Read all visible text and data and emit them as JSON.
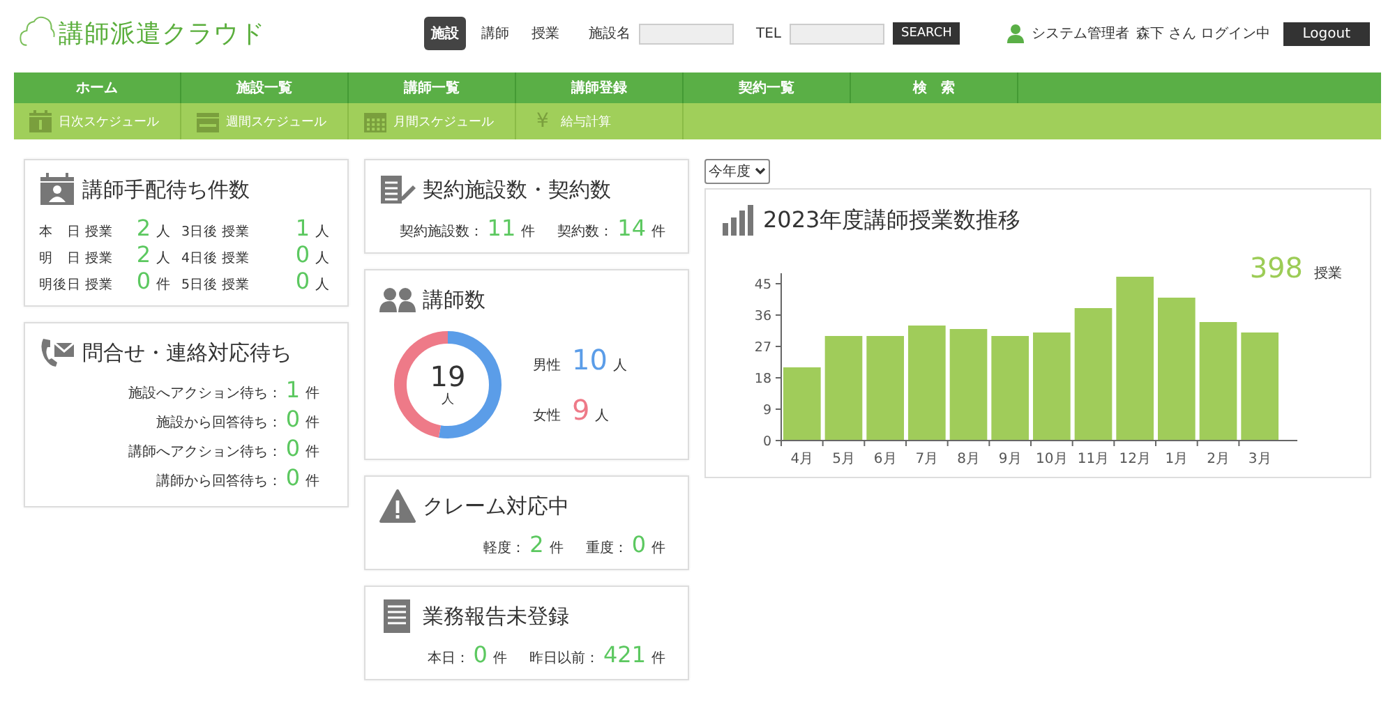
{
  "logo": "講師派遣クラウド",
  "search": {
    "tabs": [
      {
        "label": "施設",
        "selected": true
      },
      {
        "label": "講師",
        "selected": false
      },
      {
        "label": "授業",
        "selected": false
      }
    ],
    "fields": [
      {
        "label": "施設名"
      },
      {
        "label": "TEL"
      }
    ],
    "button": "SEARCH"
  },
  "user": {
    "role": "システム管理者",
    "status": "森下 さん ログイン中",
    "logout": "Logout"
  },
  "main_nav": [
    "ホーム",
    "施設一覧",
    "講師一覧",
    "講師登録",
    "契約一覧",
    "検　索"
  ],
  "sub_nav": [
    {
      "kind": "day",
      "label": "日次スケジュール"
    },
    {
      "kind": "week",
      "label": "週間スケジュール"
    },
    {
      "kind": "month",
      "label": "月間スケジュール"
    },
    {
      "kind": "glyph",
      "icon": "¥",
      "label": "給与計算"
    }
  ],
  "left_cards": [
    {
      "kind": "grid",
      "title": "講師手配待ち件数",
      "items": [
        {
          "label": "本　日 授業",
          "value": "2",
          "unit": "人"
        },
        {
          "label": "3日後 授業",
          "value": "1",
          "unit": "人"
        },
        {
          "label": "明　日 授業",
          "value": "2",
          "unit": "人"
        },
        {
          "label": "4日後 授業",
          "value": "0",
          "unit": "人"
        },
        {
          "label": "明後日 授業",
          "value": "0",
          "unit": "件"
        },
        {
          "label": "5日後 授業",
          "value": "0",
          "unit": "人"
        }
      ]
    },
    {
      "kind": "list",
      "title": "問合せ・連絡対応待ち",
      "items": [
        {
          "label": "施設へアクション待ち：",
          "value": "1",
          "unit": "件"
        },
        {
          "label": "施設から回答待ち：",
          "value": "0",
          "unit": "件"
        },
        {
          "label": "講師へアクション待ち：",
          "value": "0",
          "unit": "件"
        },
        {
          "label": "講師から回答待ち：",
          "value": "0",
          "unit": "件"
        }
      ]
    }
  ],
  "middle_cards": [
    {
      "kind": "inline",
      "title": "契約施設数・契約数",
      "items": [
        {
          "label": "契約施設数：",
          "value": "11",
          "unit": "件"
        },
        {
          "label": "契約数：",
          "value": "14",
          "unit": "件"
        }
      ]
    },
    {
      "kind": "donut",
      "title": "講師数",
      "total": "19",
      "total_unit": "人",
      "items": [
        {
          "label": "男性",
          "value": "10",
          "unit": "人",
          "color": "#5b9de8"
        },
        {
          "label": "女性",
          "value": "9",
          "unit": "人",
          "color": "#ee7a88"
        }
      ]
    },
    {
      "kind": "inline",
      "title": "クレーム対応中",
      "items": [
        {
          "label": "軽度：",
          "value": "2",
          "unit": "件"
        },
        {
          "label": "重度：",
          "value": "0",
          "unit": "件"
        }
      ]
    },
    {
      "kind": "inline",
      "title": "業務報告未登録",
      "items": [
        {
          "label": "本日：",
          "value": "0",
          "unit": "件"
        },
        {
          "label": "昨日以前：",
          "value": "421",
          "unit": "件"
        }
      ]
    }
  ],
  "year_select": "今年度",
  "chart_card": {
    "title": "2023年度講師授業数推移",
    "total": "398",
    "total_unit": "授業",
    "chart_data": {
      "type": "bar",
      "categories": [
        "4月",
        "5月",
        "6月",
        "7月",
        "8月",
        "9月",
        "10月",
        "11月",
        "12月",
        "1月",
        "2月",
        "3月"
      ],
      "series": [
        {
          "color": "#a0cc5a",
          "values": [
            21,
            30,
            30,
            33,
            32,
            30,
            31,
            38,
            47,
            41,
            34,
            31
          ]
        }
      ],
      "ylim": [
        0,
        48
      ],
      "yticks": [
        0,
        9,
        18,
        27,
        36,
        45
      ]
    }
  }
}
